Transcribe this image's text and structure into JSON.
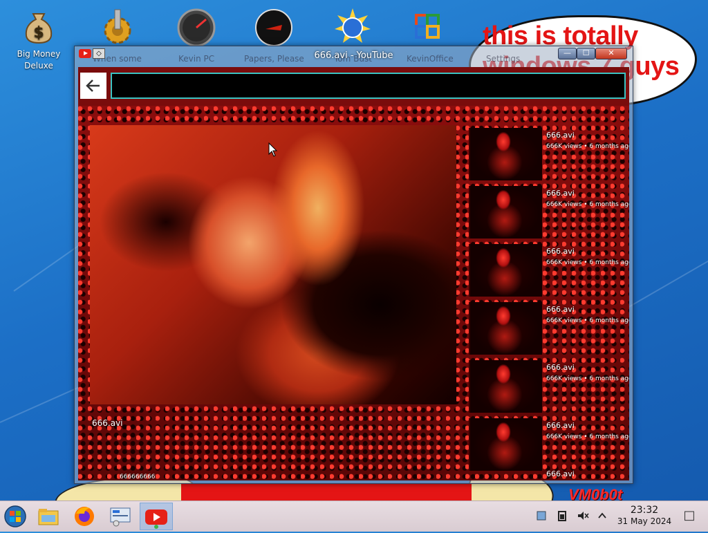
{
  "desktop": {
    "icons": [
      {
        "label": "Big Money\nDeluxe",
        "icon": "money-bag-icon"
      },
      {
        "label": "",
        "icon": "gear-icon"
      },
      {
        "label": "",
        "icon": "speedometer-icon"
      },
      {
        "label": "",
        "icon": "dark-disc-icon"
      },
      {
        "label": "",
        "icon": "globe-sunburst-icon"
      },
      {
        "label": "",
        "icon": "office-logo-icon"
      }
    ],
    "bubble_text": "this is totally\nwindows 7 guys",
    "signature": "VM0b0t"
  },
  "window": {
    "title": "666.avi - YouTube",
    "ghost_labels": [
      "When some",
      "Kevin PC",
      "Papers, Please",
      "Tom Bust",
      "KevinOffice",
      "Settings"
    ],
    "controls": {
      "minimize": "—",
      "maximize": "☐",
      "close": "✕"
    },
    "back_glyph": "🡐",
    "url": ""
  },
  "video": {
    "title": "666.avi",
    "views": "666666666"
  },
  "recommendations": [
    {
      "title": "666.avi",
      "meta": "666K views • 6 months ago"
    },
    {
      "title": "666.avi",
      "meta": "666K views • 6 months ago"
    },
    {
      "title": "666.avi",
      "meta": "666K views • 6 months ago"
    },
    {
      "title": "666.avi",
      "meta": "666K views • 6 months ago"
    },
    {
      "title": "666.avi",
      "meta": "666K views • 6 months ago"
    },
    {
      "title": "666.avi",
      "meta": "666K views • 6 months ago"
    },
    {
      "title": "666.avi",
      "meta": ""
    }
  ],
  "taskbar": {
    "items": [
      "start-orb-icon",
      "file-explorer-icon",
      "firefox-icon",
      "control-panel-icon",
      "youtube-icon"
    ],
    "tray": [
      "network-icon",
      "battery-icon",
      "volume-muted-icon",
      "chevron-up-icon"
    ],
    "time": "23:32",
    "date": "31 May 2024",
    "show_desktop": "□"
  }
}
